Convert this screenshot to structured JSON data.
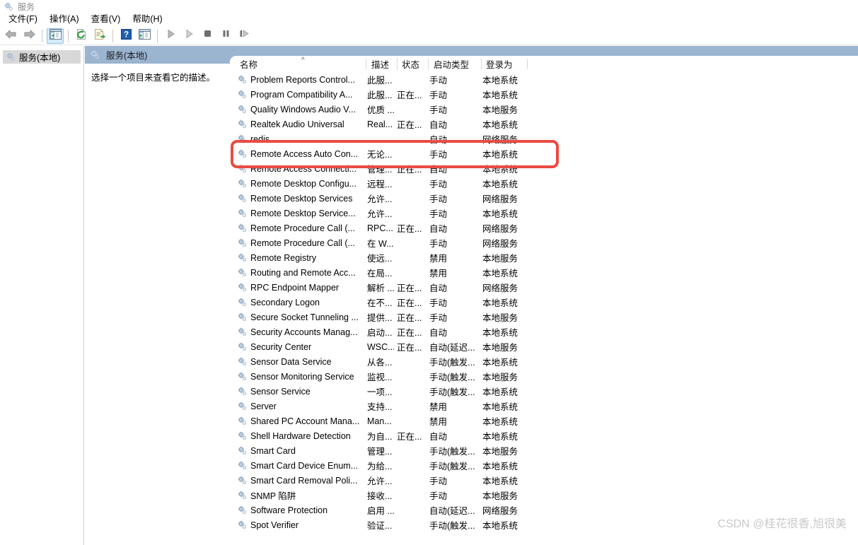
{
  "window": {
    "title": "服务",
    "title_icon": "services-gear-icon"
  },
  "menubar": {
    "items": [
      {
        "label": "文件(F)",
        "name": "menu-file"
      },
      {
        "label": "操作(A)",
        "name": "menu-action"
      },
      {
        "label": "查看(V)",
        "name": "menu-view"
      },
      {
        "label": "帮助(H)",
        "name": "menu-help"
      }
    ]
  },
  "toolbar": {
    "buttons": [
      {
        "name": "back-icon",
        "tip": "后退"
      },
      {
        "name": "forward-icon",
        "tip": "前进"
      },
      {
        "name": "show-hide-tree-icon",
        "tip": "显示/隐藏控制台树",
        "active": true
      },
      {
        "name": "refresh-icon",
        "tip": "刷新"
      },
      {
        "name": "export-list-icon",
        "tip": "导出列表"
      },
      {
        "name": "help-icon",
        "tip": "帮助"
      },
      {
        "name": "properties-icon",
        "tip": "属性"
      },
      {
        "name": "start-service-icon",
        "tip": "启动服务"
      },
      {
        "name": "resume-service-icon",
        "tip": "恢复服务"
      },
      {
        "name": "stop-service-icon",
        "tip": "停止服务"
      },
      {
        "name": "pause-service-icon",
        "tip": "暂停服务"
      },
      {
        "name": "restart-service-icon",
        "tip": "重启服务"
      }
    ]
  },
  "tree": {
    "node_label": "服务(本地)",
    "node_icon": "services-gear-icon"
  },
  "detail": {
    "header_label": "服务(本地)",
    "header_icon": "services-gear-icon",
    "description_hint": "选择一个项目来查看它的描述。"
  },
  "list": {
    "columns": [
      {
        "key": "name",
        "label": "名称",
        "sorted": true,
        "sort_dir": "asc"
      },
      {
        "key": "desc",
        "label": "描述"
      },
      {
        "key": "state",
        "label": "状态"
      },
      {
        "key": "start",
        "label": "启动类型"
      },
      {
        "key": "logon",
        "label": "登录为"
      }
    ],
    "row_icon": "service-gear-icon",
    "rows": [
      {
        "name": "Problem Reports Control...",
        "desc": "此服...",
        "state": "",
        "start": "手动",
        "logon": "本地系统"
      },
      {
        "name": "Program Compatibility A...",
        "desc": "此服...",
        "state": "正在...",
        "start": "手动",
        "logon": "本地系统"
      },
      {
        "name": "Quality Windows Audio V...",
        "desc": "优质 ...",
        "state": "",
        "start": "手动",
        "logon": "本地服务"
      },
      {
        "name": "Realtek Audio Universal",
        "desc": "Real...",
        "state": "正在...",
        "start": "自动",
        "logon": "本地系统"
      },
      {
        "name": "redis",
        "desc": "",
        "state": "",
        "start": "自动",
        "logon": "网络服务",
        "highlighted": true
      },
      {
        "name": "Remote Access Auto Con...",
        "desc": "无论...",
        "state": "",
        "start": "手动",
        "logon": "本地系统"
      },
      {
        "name": "Remote Access Connecti...",
        "desc": "管理...",
        "state": "正在...",
        "start": "自动",
        "logon": "本地系统"
      },
      {
        "name": "Remote Desktop Configu...",
        "desc": "远程...",
        "state": "",
        "start": "手动",
        "logon": "本地系统"
      },
      {
        "name": "Remote Desktop Services",
        "desc": "允许...",
        "state": "",
        "start": "手动",
        "logon": "网络服务"
      },
      {
        "name": "Remote Desktop Service...",
        "desc": "允许...",
        "state": "",
        "start": "手动",
        "logon": "本地系统"
      },
      {
        "name": "Remote Procedure Call (...",
        "desc": "RPC...",
        "state": "正在...",
        "start": "自动",
        "logon": "网络服务"
      },
      {
        "name": "Remote Procedure Call (...",
        "desc": "在 W...",
        "state": "",
        "start": "手动",
        "logon": "网络服务"
      },
      {
        "name": "Remote Registry",
        "desc": "使远...",
        "state": "",
        "start": "禁用",
        "logon": "本地服务"
      },
      {
        "name": "Routing and Remote Acc...",
        "desc": "在局...",
        "state": "",
        "start": "禁用",
        "logon": "本地系统"
      },
      {
        "name": "RPC Endpoint Mapper",
        "desc": "解析 ...",
        "state": "正在...",
        "start": "自动",
        "logon": "网络服务"
      },
      {
        "name": "Secondary Logon",
        "desc": "在不...",
        "state": "正在...",
        "start": "手动",
        "logon": "本地系统"
      },
      {
        "name": "Secure Socket Tunneling ...",
        "desc": "提供...",
        "state": "正在...",
        "start": "手动",
        "logon": "本地服务"
      },
      {
        "name": "Security Accounts Manag...",
        "desc": "启动...",
        "state": "正在...",
        "start": "自动",
        "logon": "本地系统"
      },
      {
        "name": "Security Center",
        "desc": "WSC...",
        "state": "正在...",
        "start": "自动(延迟...",
        "logon": "本地服务"
      },
      {
        "name": "Sensor Data Service",
        "desc": "从各...",
        "state": "",
        "start": "手动(触发...",
        "logon": "本地系统"
      },
      {
        "name": "Sensor Monitoring Service",
        "desc": "监视...",
        "state": "",
        "start": "手动(触发...",
        "logon": "本地服务"
      },
      {
        "name": "Sensor Service",
        "desc": "一项...",
        "state": "",
        "start": "手动(触发...",
        "logon": "本地系统"
      },
      {
        "name": "Server",
        "desc": "支持...",
        "state": "",
        "start": "禁用",
        "logon": "本地系统"
      },
      {
        "name": "Shared PC Account Mana...",
        "desc": "Man...",
        "state": "",
        "start": "禁用",
        "logon": "本地系统"
      },
      {
        "name": "Shell Hardware Detection",
        "desc": "为自...",
        "state": "正在...",
        "start": "自动",
        "logon": "本地系统"
      },
      {
        "name": "Smart Card",
        "desc": "管理...",
        "state": "",
        "start": "手动(触发...",
        "logon": "本地服务"
      },
      {
        "name": "Smart Card Device Enum...",
        "desc": "为给...",
        "state": "",
        "start": "手动(触发...",
        "logon": "本地系统"
      },
      {
        "name": "Smart Card Removal Poli...",
        "desc": "允许...",
        "state": "",
        "start": "手动",
        "logon": "本地系统"
      },
      {
        "name": "SNMP 陷阱",
        "desc": "接收...",
        "state": "",
        "start": "手动",
        "logon": "本地服务"
      },
      {
        "name": "Software Protection",
        "desc": "启用 ...",
        "state": "",
        "start": "自动(延迟...",
        "logon": "网络服务"
      },
      {
        "name": "Spot Verifier",
        "desc": "验证...",
        "state": "",
        "start": "手动(触发...",
        "logon": "本地系统"
      }
    ]
  },
  "annotation": {
    "color": "#eb4b41",
    "target_row": "redis"
  },
  "watermark": {
    "text": "CSDN @桂花很香,旭很美",
    "color": "#c9c9c9"
  }
}
